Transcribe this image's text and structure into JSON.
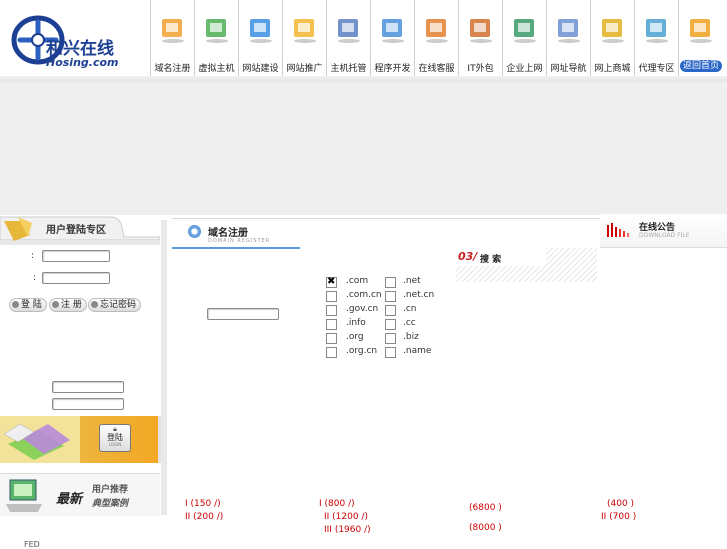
{
  "logo": {
    "name_cn": "和兴在线",
    "name_en": "Hosing.com"
  },
  "nav": [
    {
      "label": "域名注册",
      "icon": "calendar-icon"
    },
    {
      "label": "虚拟主机",
      "icon": "box-icon"
    },
    {
      "label": "网站建设",
      "icon": "monitor-icon"
    },
    {
      "label": "网站推广",
      "icon": "megaphone-icon"
    },
    {
      "label": "主机托管",
      "icon": "server-icon"
    },
    {
      "label": "程序开发",
      "icon": "laptop-icon"
    },
    {
      "label": "在线客服",
      "icon": "support-icon"
    },
    {
      "label": "IT外包",
      "icon": "package-icon"
    },
    {
      "label": "企业上网",
      "icon": "network-icon"
    },
    {
      "label": "网址导航",
      "icon": "document-icon"
    },
    {
      "label": "网上商城",
      "icon": "coins-icon"
    },
    {
      "label": "代理专区",
      "icon": "globe-icon"
    },
    {
      "label": "返回首页",
      "icon": "return-arrow-icon"
    }
  ],
  "login": {
    "title": "用户登陆专区",
    "colon1": ":",
    "colon2": ":",
    "buttons": {
      "login": "登 陆",
      "register": "注 册",
      "forgot": "忘记密码"
    },
    "promo_button": "登陆",
    "promo_button_sub": "LOGIN",
    "cases_big": "最新",
    "cases_line1": "用户推荐",
    "cases_line2": "典型案例"
  },
  "domain": {
    "title": "域名注册",
    "subtitle": "DOMAIN REGISTER",
    "tlds_left": [
      ".com",
      ".com.cn",
      ".gov.cn",
      ".info",
      ".org",
      ".org.cn"
    ],
    "tlds_right": [
      ".net",
      ".net.cn",
      ".cn",
      ".cc",
      ".biz",
      ".name"
    ],
    "checked": ".com"
  },
  "search": {
    "num": "03/",
    "title": "搜 索"
  },
  "notice": {
    "title": "在线公告",
    "subtitle": "DOWNLOAD FILE"
  },
  "prices": {
    "p1": "I (150 /)",
    "p2": "II (200 /)",
    "p3": "I (800 /)",
    "p4": "II (1200 /)",
    "p5": "III (1960 /)",
    "p6": "(6800 )",
    "p7": "(8000 )",
    "p8": "(400 )",
    "p9": "II (700 )"
  },
  "footer_fragment": "FED"
}
